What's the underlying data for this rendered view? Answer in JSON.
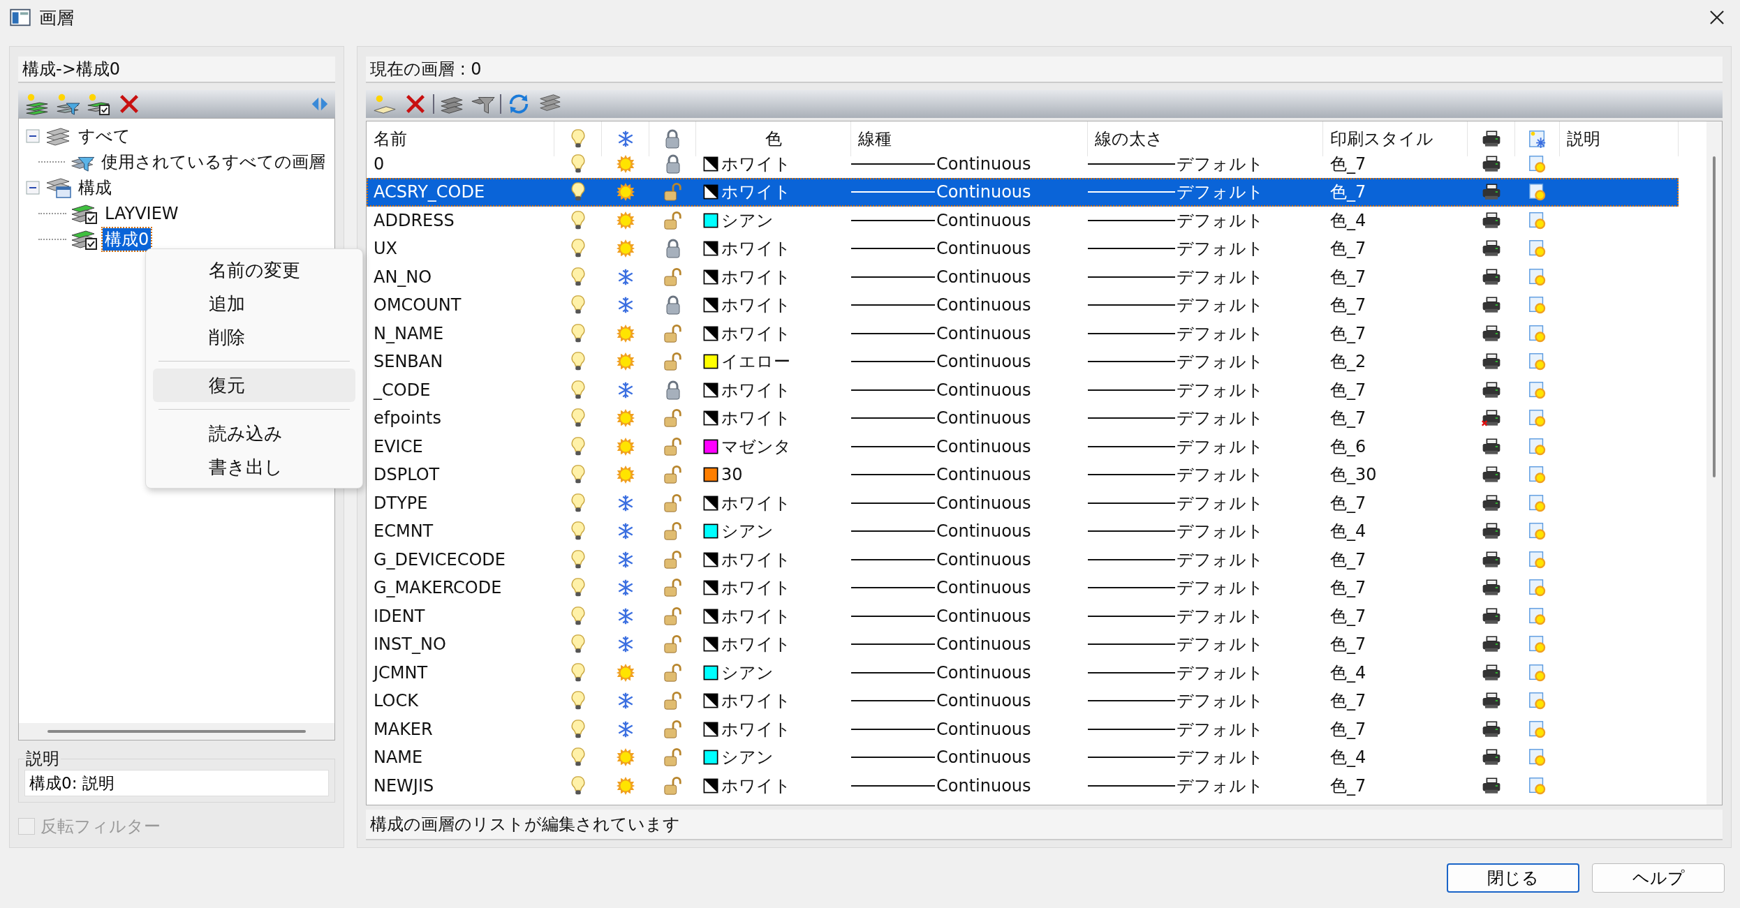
{
  "window": {
    "title": "画層"
  },
  "left_panel": {
    "path": "構成->構成0",
    "tree": [
      {
        "label": "すべて",
        "kind": "all",
        "expanded": true,
        "selected": false,
        "children": [
          {
            "label": "使用されているすべての画層",
            "kind": "filter",
            "selected": false
          }
        ]
      },
      {
        "label": "構成",
        "kind": "group",
        "expanded": true,
        "selected": false,
        "children": [
          {
            "label": "LAYVIEW",
            "kind": "state",
            "selected": false
          },
          {
            "label": "構成0",
            "kind": "state",
            "selected": true
          }
        ]
      }
    ],
    "description": {
      "label": "説明",
      "value": "構成0: 説明"
    },
    "invert_filter": {
      "label": "反転フィルター",
      "checked": false,
      "disabled": true
    }
  },
  "context_menu": {
    "groups": [
      [
        {
          "label": "名前の変更",
          "selected": false
        },
        {
          "label": "追加",
          "selected": false
        },
        {
          "label": "削除",
          "selected": false
        }
      ],
      [
        {
          "label": "復元",
          "selected": true
        }
      ],
      [
        {
          "label": "読み込み",
          "selected": false
        },
        {
          "label": "書き出し",
          "selected": false
        }
      ]
    ]
  },
  "right_panel": {
    "current_layer": "現在の画層 : 0",
    "table": {
      "columns": [
        "名前",
        "色",
        "線種",
        "線の太さ",
        "印刷スタイル",
        "説明"
      ],
      "rows": [
        {
          "name": "0",
          "on": true,
          "frozen": false,
          "locked": true,
          "color": "#ffffff",
          "color_name": "ホワイト",
          "linetype": "Continuous",
          "lineweight": "デフォルト",
          "plot_style": "色_7",
          "plot": true,
          "selected": false
        },
        {
          "name": "ACSRY_CODE",
          "on": true,
          "frozen": false,
          "locked": false,
          "color": "#ffffff",
          "color_name": "ホワイト",
          "linetype": "Continuous",
          "lineweight": "デフォルト",
          "plot_style": "色_7",
          "plot": true,
          "selected": true
        },
        {
          "name": "ADDRESS",
          "on": true,
          "frozen": false,
          "locked": false,
          "color": "#00ffff",
          "color_name": "シアン",
          "linetype": "Continuous",
          "lineweight": "デフォルト",
          "plot_style": "色_4",
          "plot": true,
          "selected": false
        },
        {
          "name": "UX",
          "on": true,
          "frozen": false,
          "locked": true,
          "color": "#ffffff",
          "color_name": "ホワイト",
          "linetype": "Continuous",
          "lineweight": "デフォルト",
          "plot_style": "色_7",
          "plot": true,
          "selected": false
        },
        {
          "name": "AN_NO",
          "on": true,
          "frozen": true,
          "locked": false,
          "color": "#ffffff",
          "color_name": "ホワイト",
          "linetype": "Continuous",
          "lineweight": "デフォルト",
          "plot_style": "色_7",
          "plot": true,
          "selected": false
        },
        {
          "name": "OMCOUNT",
          "on": true,
          "frozen": true,
          "locked": true,
          "color": "#ffffff",
          "color_name": "ホワイト",
          "linetype": "Continuous",
          "lineweight": "デフォルト",
          "plot_style": "色_7",
          "plot": true,
          "selected": false
        },
        {
          "name": "N_NAME",
          "on": true,
          "frozen": false,
          "locked": false,
          "color": "#ffffff",
          "color_name": "ホワイト",
          "linetype": "Continuous",
          "lineweight": "デフォルト",
          "plot_style": "色_7",
          "plot": true,
          "selected": false
        },
        {
          "name": "SENBAN",
          "on": true,
          "frozen": false,
          "locked": false,
          "color": "#ffff00",
          "color_name": "イエロー",
          "linetype": "Continuous",
          "lineweight": "デフォルト",
          "plot_style": "色_2",
          "plot": true,
          "selected": false
        },
        {
          "name": "_CODE",
          "on": true,
          "frozen": true,
          "locked": true,
          "color": "#ffffff",
          "color_name": "ホワイト",
          "linetype": "Continuous",
          "lineweight": "デフォルト",
          "plot_style": "色_7",
          "plot": true,
          "selected": false
        },
        {
          "name": "efpoints",
          "on": true,
          "frozen": false,
          "locked": false,
          "color": "#ffffff",
          "color_name": "ホワイト",
          "linetype": "Continuous",
          "lineweight": "デフォルト",
          "plot_style": "色_7",
          "plot": false,
          "selected": false
        },
        {
          "name": "EVICE",
          "on": true,
          "frozen": false,
          "locked": false,
          "color": "#ff00ff",
          "color_name": "マゼンタ",
          "linetype": "Continuous",
          "lineweight": "デフォルト",
          "plot_style": "色_6",
          "plot": true,
          "selected": false
        },
        {
          "name": "DSPLOT",
          "on": true,
          "frozen": false,
          "locked": false,
          "color": "#ff7f00",
          "color_name": "30",
          "linetype": "Continuous",
          "lineweight": "デフォルト",
          "plot_style": "色_30",
          "plot": true,
          "selected": false
        },
        {
          "name": "DTYPE",
          "on": true,
          "frozen": true,
          "locked": false,
          "color": "#ffffff",
          "color_name": "ホワイト",
          "linetype": "Continuous",
          "lineweight": "デフォルト",
          "plot_style": "色_7",
          "plot": true,
          "selected": false
        },
        {
          "name": "ECMNT",
          "on": true,
          "frozen": true,
          "locked": false,
          "color": "#00ffff",
          "color_name": "シアン",
          "linetype": "Continuous",
          "lineweight": "デフォルト",
          "plot_style": "色_4",
          "plot": true,
          "selected": false
        },
        {
          "name": "G_DEVICECODE",
          "on": true,
          "frozen": true,
          "locked": false,
          "color": "#ffffff",
          "color_name": "ホワイト",
          "linetype": "Continuous",
          "lineweight": "デフォルト",
          "plot_style": "色_7",
          "plot": true,
          "selected": false
        },
        {
          "name": "G_MAKERCODE",
          "on": true,
          "frozen": true,
          "locked": false,
          "color": "#ffffff",
          "color_name": "ホワイト",
          "linetype": "Continuous",
          "lineweight": "デフォルト",
          "plot_style": "色_7",
          "plot": true,
          "selected": false
        },
        {
          "name": "IDENT",
          "on": true,
          "frozen": true,
          "locked": false,
          "color": "#ffffff",
          "color_name": "ホワイト",
          "linetype": "Continuous",
          "lineweight": "デフォルト",
          "plot_style": "色_7",
          "plot": true,
          "selected": false
        },
        {
          "name": "INST_NO",
          "on": true,
          "frozen": true,
          "locked": false,
          "color": "#ffffff",
          "color_name": "ホワイト",
          "linetype": "Continuous",
          "lineweight": "デフォルト",
          "plot_style": "色_7",
          "plot": true,
          "selected": false
        },
        {
          "name": "JCMNT",
          "on": true,
          "frozen": false,
          "locked": false,
          "color": "#00ffff",
          "color_name": "シアン",
          "linetype": "Continuous",
          "lineweight": "デフォルト",
          "plot_style": "色_4",
          "plot": true,
          "selected": false
        },
        {
          "name": "LOCK",
          "on": true,
          "frozen": true,
          "locked": false,
          "color": "#ffffff",
          "color_name": "ホワイト",
          "linetype": "Continuous",
          "lineweight": "デフォルト",
          "plot_style": "色_7",
          "plot": true,
          "selected": false
        },
        {
          "name": "MAKER",
          "on": true,
          "frozen": true,
          "locked": false,
          "color": "#ffffff",
          "color_name": "ホワイト",
          "linetype": "Continuous",
          "lineweight": "デフォルト",
          "plot_style": "色_7",
          "plot": true,
          "selected": false
        },
        {
          "name": "NAME",
          "on": true,
          "frozen": false,
          "locked": false,
          "color": "#00ffff",
          "color_name": "シアン",
          "linetype": "Continuous",
          "lineweight": "デフォルト",
          "plot_style": "色_4",
          "plot": true,
          "selected": false
        },
        {
          "name": "NEWJIS",
          "on": true,
          "frozen": false,
          "locked": false,
          "color": "#ffffff",
          "color_name": "ホワイト",
          "linetype": "Continuous",
          "lineweight": "デフォルト",
          "plot_style": "色_7",
          "plot": true,
          "selected": false
        }
      ]
    },
    "status": "構成の画層のリストが編集されています"
  },
  "buttons": [
    {
      "label": "閉じる",
      "default": true
    },
    {
      "label": "ヘルプ",
      "default": false
    }
  ]
}
